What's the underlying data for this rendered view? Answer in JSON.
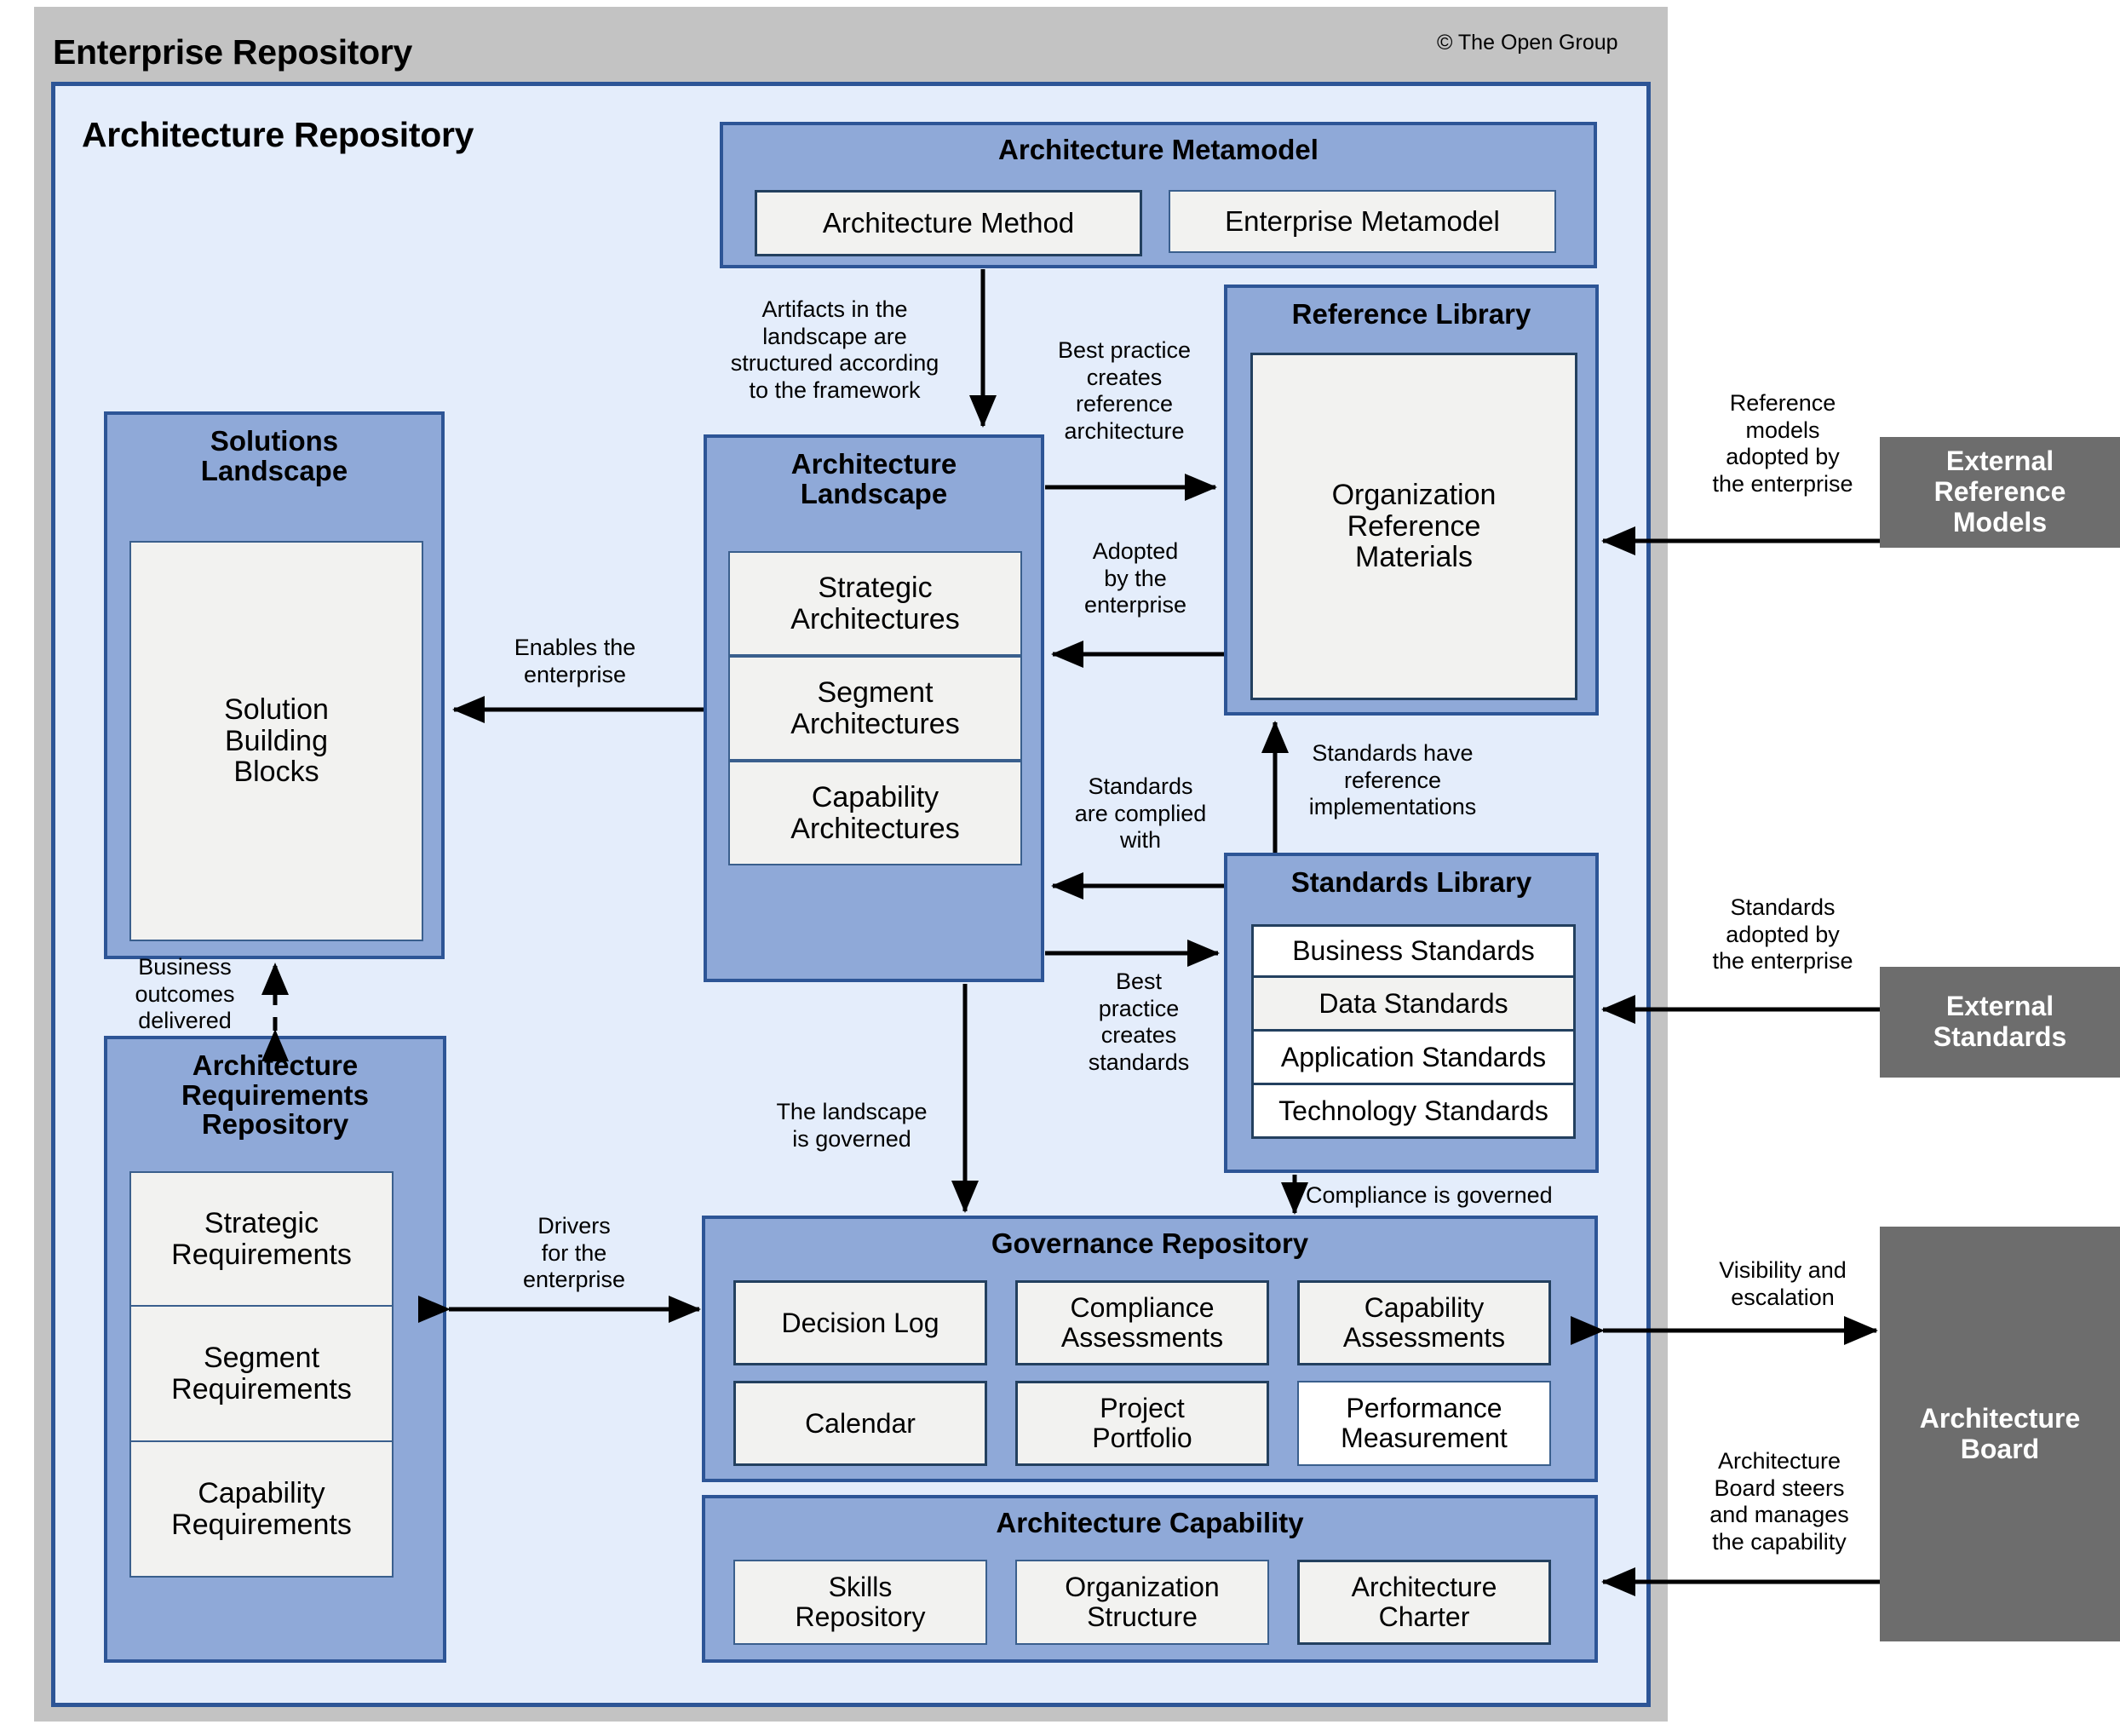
{
  "diagram": {
    "outer_title": "Enterprise Repository",
    "copyright": "© The Open Group",
    "inner_title": "Architecture Repository",
    "colors": {
      "outer_frame": "#c3c3c3",
      "inner_frame_fill": "#e4edfb",
      "inner_frame_border": "#2d5596",
      "group_fill": "#8fa9d8",
      "group_border": "#2d5596",
      "leaf_fill": "#f2f2f0",
      "leaf_border": "#23405f",
      "external_fill": "#6d6d6d",
      "external_text": "#ffffff",
      "connector": "#000000"
    }
  },
  "groups": {
    "architecture_metamodel": {
      "title": "Architecture Metamodel",
      "items": [
        "Architecture Method",
        "Enterprise Metamodel"
      ]
    },
    "reference_library": {
      "title": "Reference Library",
      "items": [
        "Organization\nReference\nMaterials"
      ]
    },
    "solutions_landscape": {
      "title": "Solutions\nLandscape",
      "items": [
        "Solution\nBuilding\nBlocks"
      ]
    },
    "architecture_landscape": {
      "title": "Architecture\nLandscape",
      "items": [
        "Strategic\nArchitectures",
        "Segment\nArchitectures",
        "Capability\nArchitectures"
      ]
    },
    "standards_library": {
      "title": "Standards Library",
      "items": [
        "Business Standards",
        "Data Standards",
        "Application Standards",
        "Technology Standards"
      ]
    },
    "architecture_requirements_repository": {
      "title": "Architecture\nRequirements\nRepository",
      "items": [
        "Strategic\nRequirements",
        "Segment\nRequirements",
        "Capability\nRequirements"
      ]
    },
    "governance_repository": {
      "title": "Governance Repository",
      "items": [
        "Decision Log",
        "Compliance\nAssessments",
        "Capability\nAssessments",
        "Calendar",
        "Project\nPortfolio",
        "Performance\nMeasurement"
      ]
    },
    "architecture_capability": {
      "title": "Architecture Capability",
      "items": [
        "Skills\nRepository",
        "Organization\nStructure",
        "Architecture\nCharter"
      ]
    }
  },
  "external_entities": [
    {
      "label": "External\nReference\nModels"
    },
    {
      "label": "External\nStandards"
    },
    {
      "label": "Architecture\nBoard"
    }
  ],
  "annotations": [
    {
      "id": "artifacts-structured",
      "text": "Artifacts in the\nlandscape  are\nstructured according\nto the framework"
    },
    {
      "id": "best-practice-reference",
      "text": "Best practice\ncreates\nreference\narchitecture"
    },
    {
      "id": "adopted-by-enterprise",
      "text": "Adopted\nby the\nenterprise"
    },
    {
      "id": "enables-the-enterprise",
      "text": "Enables  the\nenterprise"
    },
    {
      "id": "standards-complied-with",
      "text": "Standards\nare complied\nwith"
    },
    {
      "id": "standards-reference-impl",
      "text": "Standards  have\nreference\nimplementations"
    },
    {
      "id": "best-practice-standards",
      "text": "Best\npractice\ncreates\nstandards"
    },
    {
      "id": "business-outcomes",
      "text": "Business\noutcomes\ndelivered"
    },
    {
      "id": "landscape-governed",
      "text": "The landscape\nis governed"
    },
    {
      "id": "drivers-for-enterprise",
      "text": "Drivers\nfor the\nenterprise"
    },
    {
      "id": "compliance-governed",
      "text": "Compliance  is governed"
    },
    {
      "id": "reference-models-adopted",
      "text": "Reference\nmodels\nadopted by\nthe enterprise"
    },
    {
      "id": "standards-adopted",
      "text": "Standards\nadopted by\nthe enterprise"
    },
    {
      "id": "visibility-escalation",
      "text": "Visibility and\nescalation"
    },
    {
      "id": "board-steers",
      "text": "Architecture\nBoard steers\nand manages\nthe capability"
    }
  ]
}
